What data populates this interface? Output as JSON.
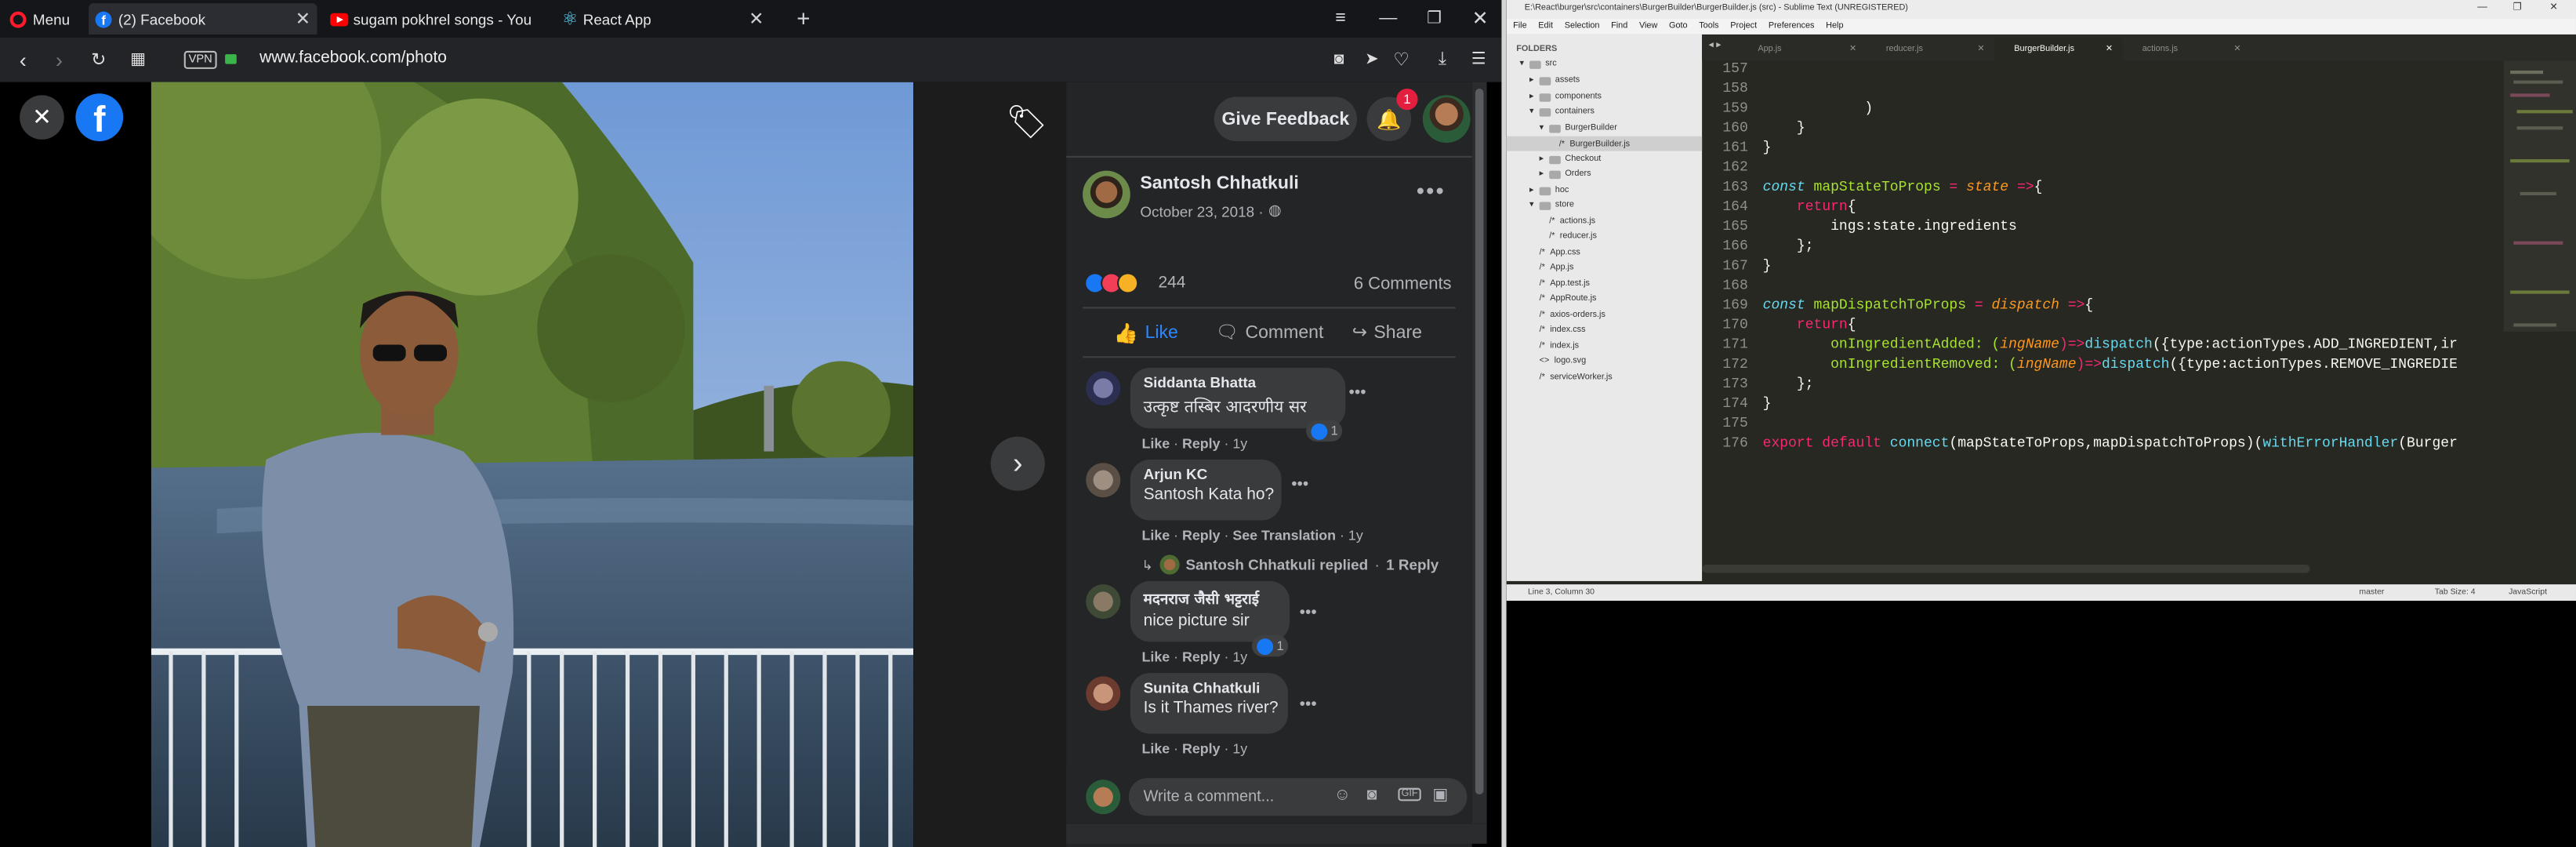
{
  "browser": {
    "menu_label": "Menu",
    "tabs": [
      {
        "title": "(2) Facebook",
        "icon": "facebook-icon"
      },
      {
        "title": "sugam pokhrel songs - You",
        "icon": "youtube-icon"
      },
      {
        "title": "React App",
        "icon": "react-icon"
      }
    ],
    "vpn_label": "VPN",
    "url": "www.facebook.com/photo"
  },
  "fb": {
    "give_feedback": "Give Feedback",
    "notif_count": "1",
    "post_author": "Santosh Chhatkuli",
    "post_date": "October 23, 2018 ·",
    "reaction_count": "244",
    "comments_count": "6 Comments",
    "actions": {
      "like": "Like",
      "comment": "Comment",
      "share": "Share"
    },
    "comments": [
      {
        "name": "Siddanta Bhatta",
        "text": "उत्कृष्ट तस्बिर आदरणीय सर",
        "like": "Like",
        "reply": "Reply",
        "time": "1y",
        "reacts": "1"
      },
      {
        "name": "Arjun KC",
        "text": "Santosh Kata ho?",
        "like": "Like",
        "reply": "Reply",
        "translation": "See Translation",
        "time": "1y",
        "replied_text": "Santosh Chhatkuli replied",
        "replies": "1 Reply"
      },
      {
        "name": "मदनराज जैसी भट्टराई",
        "text": "nice picture sir",
        "like": "Like",
        "reply": "Reply",
        "time": "1y",
        "reacts": "1"
      },
      {
        "name": "Sunita Chhatkuli",
        "text": "Is it Thames river?",
        "like": "Like",
        "reply": "Reply",
        "time": "1y"
      }
    ],
    "comment_placeholder": "Write a comment..."
  },
  "sublime": {
    "title": "E:\\React\\burger\\src\\containers\\BurgerBuilder\\BurgerBuilder.js (src) - Sublime Text (UNREGISTERED)",
    "menu": [
      "File",
      "Edit",
      "Selection",
      "Find",
      "View",
      "Goto",
      "Tools",
      "Project",
      "Preferences",
      "Help"
    ],
    "folders_label": "FOLDERS",
    "files": [
      "src",
      "assets",
      "components",
      "containers",
      "BurgerBuilder",
      "BurgerBuilder.js",
      "Checkout",
      "Orders",
      "hoc",
      "store",
      "actions.js",
      "reducer.js",
      "App.css",
      "App.js",
      "App.test.js",
      "AppRoute.js",
      "axios-orders.js",
      "index.css",
      "index.js",
      "logo.svg",
      "serviceWorker.js"
    ],
    "tabs": [
      "App.js",
      "reducer.js",
      "BurgerBuilder.js",
      "actions.js"
    ],
    "line_numbers": [
      "157",
      "158",
      "159",
      "160",
      "161",
      "162",
      "163",
      "164",
      "165",
      "166",
      "167",
      "168",
      "169",
      "170",
      "171",
      "172",
      "173",
      "174",
      "175",
      "176"
    ],
    "code": {
      "l157": "",
      "l158": "",
      "l159": "            )",
      "l160": "    }",
      "l161": "}",
      "l163_a": "const ",
      "l163_b": "mapStateToProps",
      "l163_c": " = ",
      "l163_d": "state",
      "l163_e": " =>",
      "l163_f": "{",
      "l164_a": "    ",
      "l164_b": "return",
      "l164_c": "{",
      "l165": "        ings:state.ingredients",
      "l166": "    };",
      "l167": "}",
      "l169_a": "const ",
      "l169_b": "mapDispatchToProps",
      "l169_c": " = ",
      "l169_d": "dispatch",
      "l169_e": " =>",
      "l169_f": "{",
      "l170_a": "    ",
      "l170_b": "return",
      "l170_c": "{",
      "l171_a": "        onIngredientAdded: (",
      "l171_b": "ingName",
      "l171_c": ")=>",
      "l171_d": "dispatch",
      "l171_e": "({type:actionTypes.ADD_INGREDIENT,ir",
      "l172_a": "        onIngredientRemoved: (",
      "l172_b": "ingName",
      "l172_c": ")=>",
      "l172_d": "dispatch",
      "l172_e": "({type:actionTypes.REMOVE_INGREDIE",
      "l173": "    };",
      "l174": "}",
      "l176_a": "export default ",
      "l176_b": "connect",
      "l176_c": "(mapStateToProps,mapDispatchToProps)(",
      "l176_d": "withErrorHandler",
      "l176_e": "(Burger"
    },
    "status_left": "Line 3, Column 30",
    "status_branch": "master",
    "status_tab": "Tab Size: 4",
    "status_syntax": "JavaScript"
  },
  "colors": {
    "fb_blue": "#1877f2",
    "notif_red": "#e41e3f",
    "sublime_bg": "#272822",
    "monokai_pink": "#f92672",
    "monokai_green": "#a6e22e"
  }
}
